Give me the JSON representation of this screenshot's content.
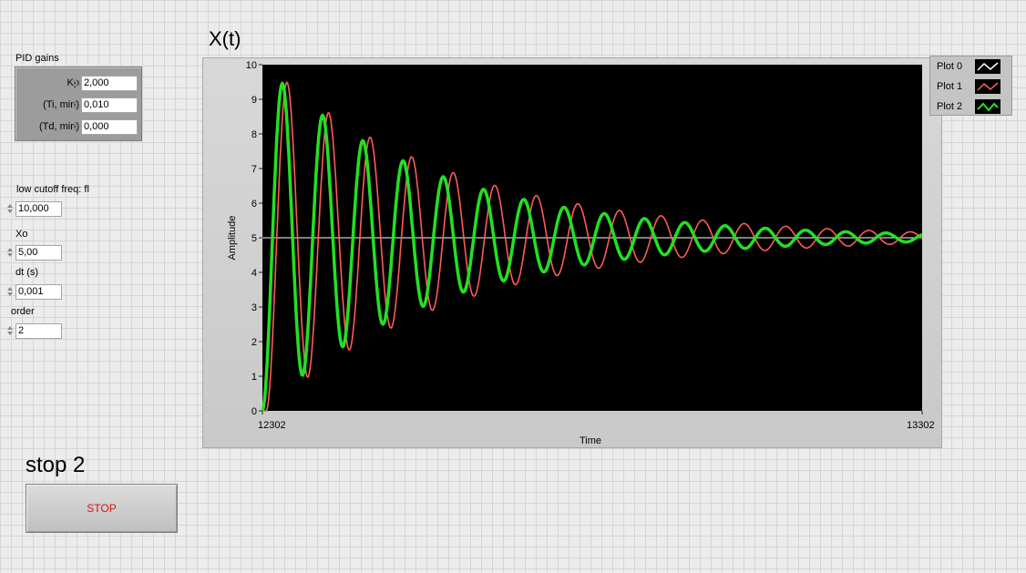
{
  "pid": {
    "title": "PID gains",
    "kp": {
      "label": "Kp",
      "value": "2,000"
    },
    "ti": {
      "label": "(Ti, min)",
      "value": "0,010"
    },
    "td": {
      "label": "(Td, min)",
      "value": "0,000"
    }
  },
  "controls": {
    "fl": {
      "label": "low cutoff freq: fl",
      "value": "10,000"
    },
    "xo": {
      "label": "Xo",
      "value": "5,00"
    },
    "dt": {
      "label": "dt (s)",
      "value": "0,001"
    },
    "order": {
      "label": "order",
      "value": "2"
    }
  },
  "stop": {
    "title": "stop 2",
    "button_label": "STOP"
  },
  "chart_data": {
    "type": "line",
    "title": "X(t)",
    "xlabel": "Time",
    "ylabel": "Amplitude",
    "xlim": [
      12302,
      13302
    ],
    "ylim": [
      0,
      10
    ],
    "y_ticks": [
      "0",
      "1",
      "2",
      "3",
      "4",
      "5",
      "6",
      "7",
      "8",
      "9",
      "10"
    ],
    "x_ticks": [
      "12302",
      "13302"
    ],
    "background": "#000000",
    "series": [
      {
        "name": "Plot 0",
        "color": "#ffffff",
        "kind": "constant",
        "value": 5
      },
      {
        "name": "Plot 1",
        "color": "#ff5a5a",
        "kind": "damped_oscillation",
        "offset": 5,
        "amplitude": 5,
        "decay": 3.45,
        "period": 63,
        "phase_lag": 6
      },
      {
        "name": "Plot 2",
        "color": "#22e022",
        "kind": "damped_oscillation",
        "offset": 5,
        "amplitude": 5,
        "decay": 3.8,
        "period": 61,
        "phase_lag": 0
      }
    ]
  }
}
